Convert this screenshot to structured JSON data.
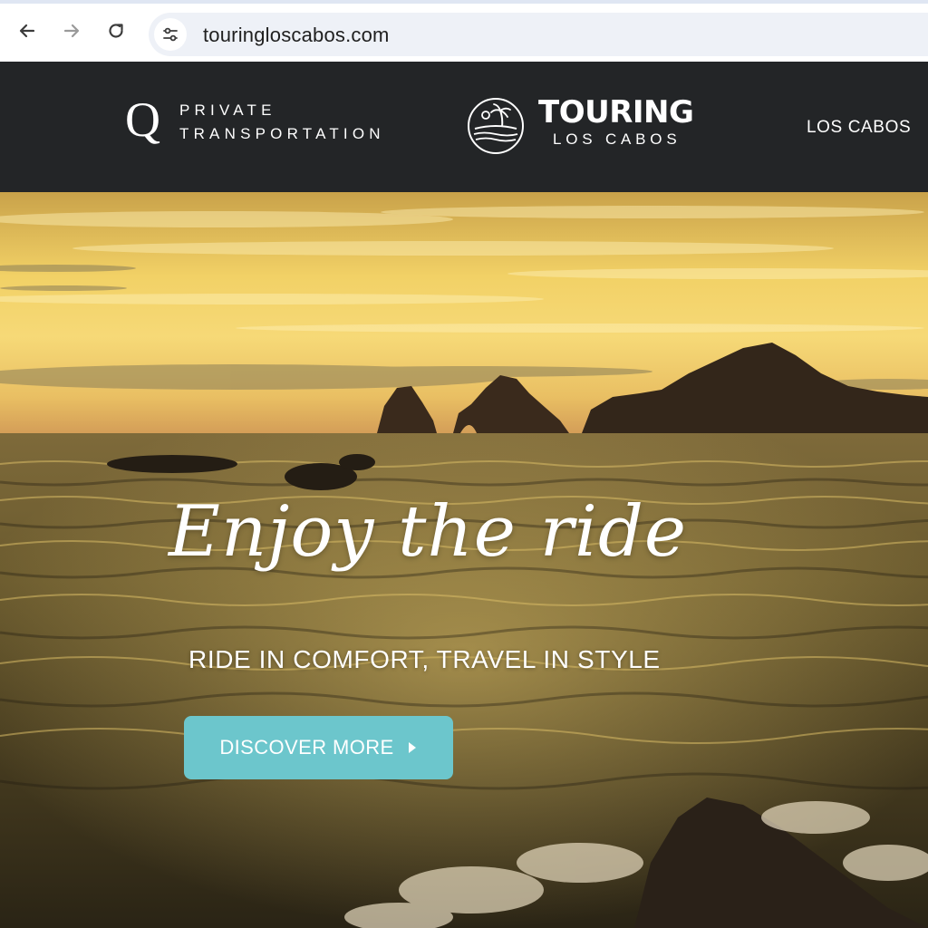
{
  "browser": {
    "url": "touringloscabos.com",
    "back_icon": "back-arrow-icon",
    "forward_icon": "forward-arrow-icon",
    "reload_icon": "reload-icon",
    "site_info_icon": "tune-icon"
  },
  "header": {
    "left_logo": {
      "letter": "Q",
      "line1": "PRIVATE",
      "line2": "TRANSPORTATION"
    },
    "center_logo": {
      "title": "TOURING",
      "subtitle": "LOS CABOS",
      "emblem_icon": "palm-sunset-emblem-icon"
    },
    "nav_link": "LOS CABOS"
  },
  "hero": {
    "script_heading": "Enjoy the ride",
    "tagline": "RIDE IN COMFORT, TRAVEL IN STYLE",
    "cta_label": "DISCOVER MORE",
    "cta_icon": "play-triangle-icon"
  },
  "colors": {
    "header_bg": "#232527",
    "cta_bg": "#6cc6cc",
    "url_pill_bg": "#eef1f7"
  }
}
